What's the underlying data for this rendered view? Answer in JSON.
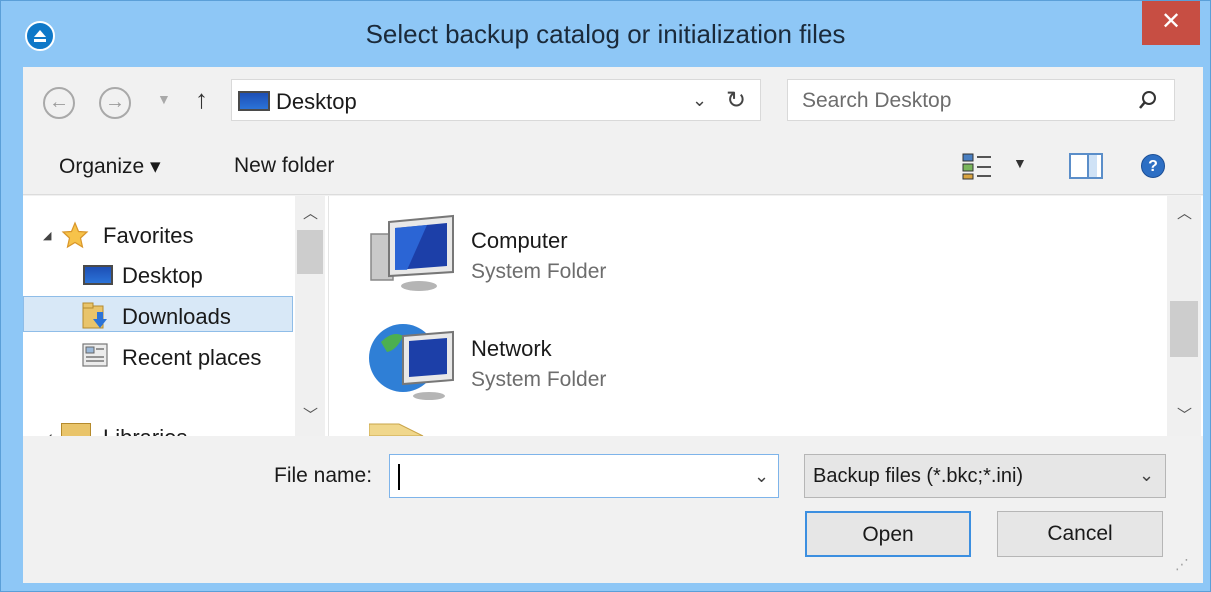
{
  "window": {
    "title": "Select backup catalog or initialization files",
    "close_glyph": "✕"
  },
  "address_bar": {
    "back_glyph": "←",
    "forward_glyph": "→",
    "up_glyph": "↑",
    "location": "Desktop",
    "search_placeholder": "Search Desktop"
  },
  "command_bar": {
    "organize_label": "Organize ▾",
    "new_folder_label": "New folder",
    "help_glyph": "?"
  },
  "navigation_pane": {
    "items": [
      {
        "label": "Favorites",
        "icon": "star-icon",
        "expander": "◢"
      },
      {
        "label": "Desktop",
        "icon": "desktop-icon"
      },
      {
        "label": "Downloads",
        "icon": "downloads-folder-icon",
        "selected": true
      },
      {
        "label": "Recent places",
        "icon": "recent-places-icon"
      },
      {
        "label": "Libraries",
        "icon": "libraries-icon",
        "expander": "◢"
      }
    ]
  },
  "content_pane": {
    "items": [
      {
        "name": "Computer",
        "type": "System Folder",
        "icon": "computer-icon"
      },
      {
        "name": "Network",
        "type": "System Folder",
        "icon": "network-icon"
      }
    ]
  },
  "file_dialog": {
    "file_name_label": "File name:",
    "file_name_value": "",
    "file_type_selected": "Backup files (*.bkc;*.ini)",
    "open_label": "Open",
    "cancel_label": "Cancel"
  }
}
